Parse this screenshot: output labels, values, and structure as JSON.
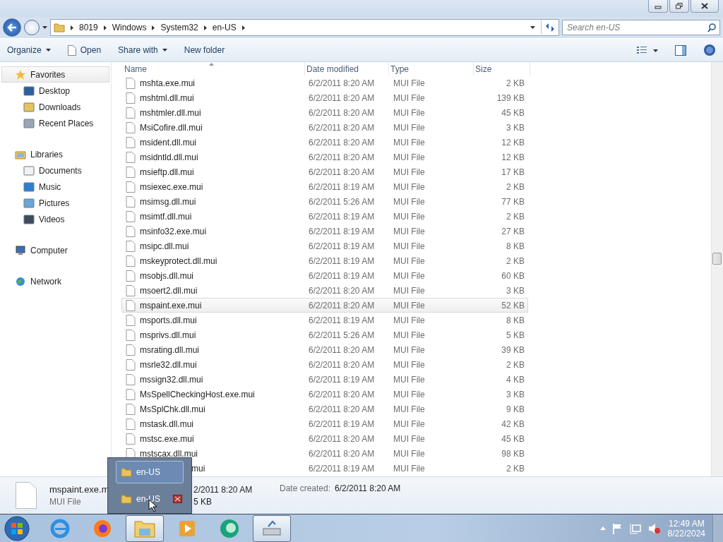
{
  "address": {
    "crumbs": [
      "8019",
      "Windows",
      "System32",
      "en-US"
    ]
  },
  "search": {
    "placeholder": "Search en-US"
  },
  "toolbar": {
    "buttons": [
      {
        "label": "Organize",
        "kind": "menu"
      },
      {
        "label": "Open",
        "kind": "file"
      },
      {
        "label": "Share with",
        "kind": "menu"
      },
      {
        "label": "New folder",
        "kind": "plain"
      }
    ]
  },
  "nav": [
    {
      "label": "Favorites",
      "selected": true,
      "children": [
        {
          "label": "Desktop",
          "selected": false
        },
        {
          "label": "Downloads",
          "selected": false
        },
        {
          "label": "Recent Places",
          "selected": false
        }
      ]
    },
    {
      "label": "Libraries",
      "selected": false,
      "children": [
        {
          "label": "Documents",
          "selected": false
        },
        {
          "label": "Music",
          "selected": false
        },
        {
          "label": "Pictures",
          "selected": false
        },
        {
          "label": "Videos",
          "selected": false
        }
      ]
    },
    {
      "label": "Computer",
      "selected": false
    },
    {
      "label": "Network",
      "selected": false
    }
  ],
  "table": {
    "columns": [
      "Name",
      "Date modified",
      "Type",
      "Size"
    ],
    "rows": [
      {
        "name": "mshta.exe.mui",
        "date": "6/2/2011 8:20 AM",
        "type": "MUI File",
        "size": "2 KB",
        "focused": false
      },
      {
        "name": "mshtml.dll.mui",
        "date": "6/2/2011 8:20 AM",
        "type": "MUI File",
        "size": "139 KB",
        "focused": false
      },
      {
        "name": "mshtmler.dll.mui",
        "date": "6/2/2011 8:20 AM",
        "type": "MUI File",
        "size": "45 KB",
        "focused": false
      },
      {
        "name": "MsiCofire.dll.mui",
        "date": "6/2/2011 8:20 AM",
        "type": "MUI File",
        "size": "3 KB",
        "focused": false
      },
      {
        "name": "msident.dll.mui",
        "date": "6/2/2011 8:20 AM",
        "type": "MUI File",
        "size": "12 KB",
        "focused": false
      },
      {
        "name": "msidntld.dll.mui",
        "date": "6/2/2011 8:20 AM",
        "type": "MUI File",
        "size": "12 KB",
        "focused": false
      },
      {
        "name": "msieftp.dll.mui",
        "date": "6/2/2011 8:20 AM",
        "type": "MUI File",
        "size": "17 KB",
        "focused": false
      },
      {
        "name": "msiexec.exe.mui",
        "date": "6/2/2011 8:19 AM",
        "type": "MUI File",
        "size": "2 KB",
        "focused": false
      },
      {
        "name": "msimsg.dll.mui",
        "date": "6/2/2011 5:26 AM",
        "type": "MUI File",
        "size": "77 KB",
        "focused": false
      },
      {
        "name": "msimtf.dll.mui",
        "date": "6/2/2011 8:19 AM",
        "type": "MUI File",
        "size": "2 KB",
        "focused": false
      },
      {
        "name": "msinfo32.exe.mui",
        "date": "6/2/2011 8:19 AM",
        "type": "MUI File",
        "size": "27 KB",
        "focused": false
      },
      {
        "name": "msipc.dll.mui",
        "date": "6/2/2011 8:19 AM",
        "type": "MUI File",
        "size": "8 KB",
        "focused": false
      },
      {
        "name": "mskeyprotect.dll.mui",
        "date": "6/2/2011 8:19 AM",
        "type": "MUI File",
        "size": "2 KB",
        "focused": false
      },
      {
        "name": "msobjs.dll.mui",
        "date": "6/2/2011 8:19 AM",
        "type": "MUI File",
        "size": "60 KB",
        "focused": false
      },
      {
        "name": "msoert2.dll.mui",
        "date": "6/2/2011 8:20 AM",
        "type": "MUI File",
        "size": "3 KB",
        "focused": false
      },
      {
        "name": "mspaint.exe.mui",
        "date": "6/2/2011 8:20 AM",
        "type": "MUI File",
        "size": "52 KB",
        "focused": true
      },
      {
        "name": "msports.dll.mui",
        "date": "6/2/2011 8:19 AM",
        "type": "MUI File",
        "size": "8 KB",
        "focused": false
      },
      {
        "name": "msprivs.dll.mui",
        "date": "6/2/2011 5:26 AM",
        "type": "MUI File",
        "size": "5 KB",
        "focused": false
      },
      {
        "name": "msrating.dll.mui",
        "date": "6/2/2011 8:20 AM",
        "type": "MUI File",
        "size": "39 KB",
        "focused": false
      },
      {
        "name": "msrle32.dll.mui",
        "date": "6/2/2011 8:20 AM",
        "type": "MUI File",
        "size": "2 KB",
        "focused": false
      },
      {
        "name": "mssign32.dll.mui",
        "date": "6/2/2011 8:19 AM",
        "type": "MUI File",
        "size": "4 KB",
        "focused": false
      },
      {
        "name": "MsSpellCheckingHost.exe.mui",
        "date": "6/2/2011 8:20 AM",
        "type": "MUI File",
        "size": "3 KB",
        "focused": false
      },
      {
        "name": "MsSplChk.dll.mui",
        "date": "6/2/2011 8:20 AM",
        "type": "MUI File",
        "size": "9 KB",
        "focused": false
      },
      {
        "name": "mstask.dll.mui",
        "date": "6/2/2011 8:19 AM",
        "type": "MUI File",
        "size": "42 KB",
        "focused": false
      },
      {
        "name": "mstsc.exe.mui",
        "date": "6/2/2011 8:20 AM",
        "type": "MUI File",
        "size": "45 KB",
        "focused": false
      },
      {
        "name": "mstscax.dll.mui",
        "date": "6/2/2011 8:20 AM",
        "type": "MUI File",
        "size": "98 KB",
        "focused": false
      },
      {
        "name": "mui",
        "date": "6/2/2011 8:19 AM",
        "type": "MUI File",
        "size": "2 KB",
        "focused": false,
        "kind": "partly_hidden"
      }
    ]
  },
  "details": {
    "name": "mspaint.exe.m",
    "type": "MUI File",
    "modified": "2/2011 8:20 AM",
    "size": "5 KB",
    "created_label": "Date created:",
    "created": "6/2/2011 8:20 AM"
  },
  "jump_popup": {
    "items": [
      {
        "label": "en-US",
        "selected": true,
        "closable": false
      },
      {
        "label": "en-US",
        "selected": false,
        "closable": true
      }
    ]
  },
  "taskbar": {
    "apps": [
      {
        "active": false
      },
      {
        "active": false
      },
      {
        "active": true
      },
      {
        "active": false
      },
      {
        "active": false
      },
      {
        "active": true
      }
    ]
  },
  "clock": {
    "time": "12:49 AM",
    "date": "8/22/2024"
  }
}
